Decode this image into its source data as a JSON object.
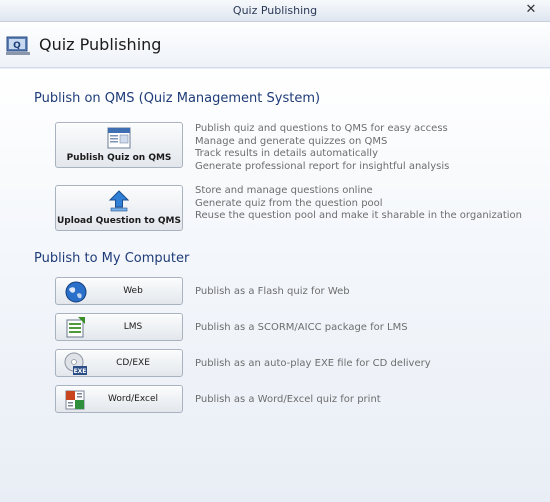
{
  "window": {
    "title": "Quiz Publishing",
    "close_glyph": "✕"
  },
  "header": {
    "title": "Quiz Publishing",
    "icon": "qms-icon"
  },
  "qms_section": {
    "title": "Publish on QMS (Quiz Management System)",
    "publish_quiz": {
      "label": "Publish Quiz on QMS",
      "icon": "qms-publish-icon",
      "desc": [
        "Publish quiz and questions to QMS for easy access",
        "Manage and generate quizzes on QMS",
        "Track  results in details automatically",
        "Generate professional report for insightful analysis"
      ]
    },
    "upload_question": {
      "label": "Upload Question to QMS",
      "icon": "upload-arrow-icon",
      "desc": [
        "Store and manage questions  online",
        "Generate quiz from the question pool",
        "Reuse the question pool and make it sharable in the organization"
      ]
    }
  },
  "computer_section": {
    "title": "Publish to My Computer",
    "web": {
      "label": "Web",
      "icon": "globe-icon",
      "desc": "Publish as a Flash quiz for Web"
    },
    "lms": {
      "label": "LMS",
      "icon": "lms-package-icon",
      "desc": "Publish as a SCORM/AICC package for LMS"
    },
    "cdexe": {
      "label": "CD/EXE",
      "icon": "cd-exe-icon",
      "desc": "Publish as an auto-play EXE file for CD delivery"
    },
    "word_excel": {
      "label": "Word/Excel",
      "icon": "word-excel-icon",
      "desc": "Publish as a Word/Excel quiz for print"
    }
  },
  "colors": {
    "section_title": "#1f3c78",
    "desc_text": "#6d6d6d",
    "background": "#e8eef7"
  }
}
